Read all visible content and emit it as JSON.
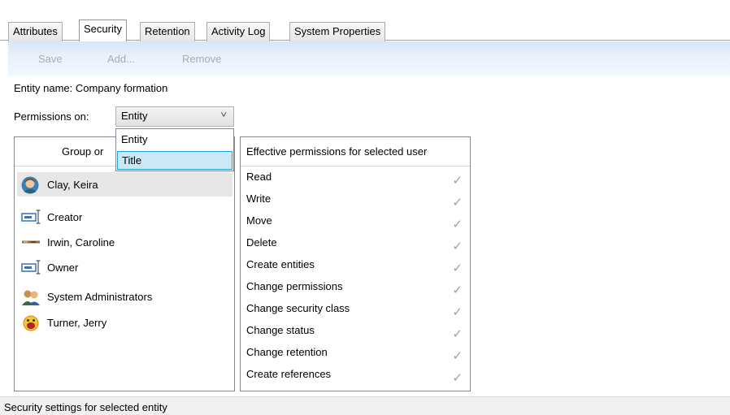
{
  "tabs": [
    "Attributes",
    "Security",
    "Retention",
    "Activity Log",
    "System Properties"
  ],
  "active_tab": "Security",
  "toolbar": {
    "save": "Save",
    "add": "Add...",
    "remove": "Remove"
  },
  "entity_name_label": "Entity name:",
  "entity_name_value": "Company formation",
  "permissions_on_label": "Permissions on:",
  "permissions_on_value": "Entity",
  "dropdown_options": [
    "Entity",
    "Title"
  ],
  "dropdown_highlighted": "Title",
  "group_header_visible": "Group or",
  "users": [
    {
      "name": "Clay, Keira",
      "icon": "user-avatar-icon",
      "selected": true
    },
    {
      "name": "Creator",
      "icon": "pseudo-user-icon"
    },
    {
      "name": "Irwin, Caroline",
      "icon": "user-photo-icon"
    },
    {
      "name": "Owner",
      "icon": "pseudo-user-icon"
    },
    {
      "name": "System Administrators",
      "icon": "group-icon"
    },
    {
      "name": "Turner, Jerry",
      "icon": "user-emoji-icon"
    }
  ],
  "effective_header": "Effective permissions for selected user",
  "permissions": [
    "Read",
    "Write",
    "Move",
    "Delete",
    "Create entities",
    "Change permissions",
    "Change security class",
    "Change status",
    "Change retention",
    "Create references"
  ],
  "checkmark_glyph": "✓",
  "status_text": "Security settings for selected entity",
  "colors": {
    "toolbar": "#dce9f8",
    "highlight": "#cbe8f6",
    "highlight_border": "#26a0da"
  }
}
